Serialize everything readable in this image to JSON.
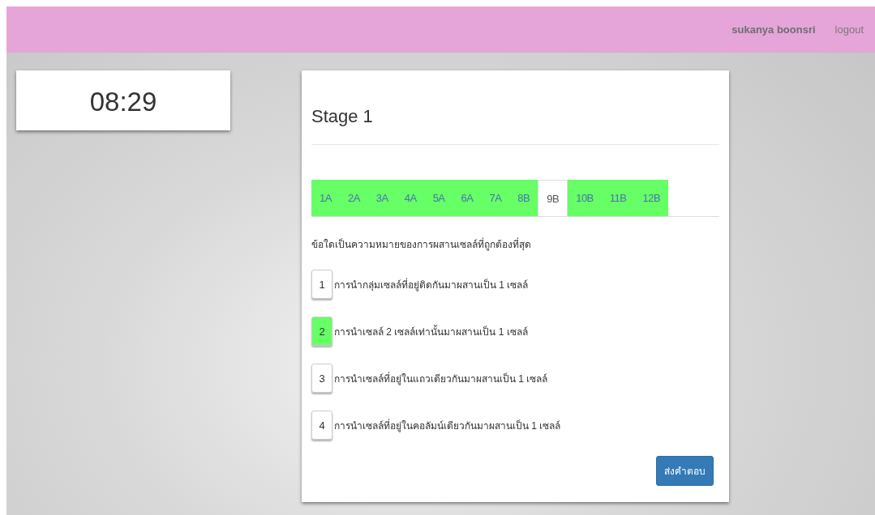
{
  "navbar": {
    "user": "sukanya boonsri",
    "logout": "logout"
  },
  "timer": "08:29",
  "stage": {
    "title": "Stage 1",
    "tabs": [
      {
        "label": "1A",
        "answered": true,
        "selected": false
      },
      {
        "label": "2A",
        "answered": true,
        "selected": false
      },
      {
        "label": "3A",
        "answered": true,
        "selected": false
      },
      {
        "label": "4A",
        "answered": true,
        "selected": false
      },
      {
        "label": "5A",
        "answered": true,
        "selected": false
      },
      {
        "label": "6A",
        "answered": true,
        "selected": false
      },
      {
        "label": "7A",
        "answered": true,
        "selected": false
      },
      {
        "label": "8B",
        "answered": true,
        "selected": false
      },
      {
        "label": "9B",
        "answered": false,
        "selected": true
      },
      {
        "label": "10B",
        "answered": true,
        "selected": false
      },
      {
        "label": "11B",
        "answered": true,
        "selected": false
      },
      {
        "label": "12B",
        "answered": true,
        "selected": false
      }
    ],
    "question": "ข้อใดเป็นความหมายของการผสานเซลล์ที่ถูกต้องที่สุด",
    "options": [
      {
        "number": "1",
        "text": "การนำกลุ่มเซลล์ที่อยู่ติดกันมาผสานเป็น 1 เซลล์",
        "selected": false
      },
      {
        "number": "2",
        "text": "การนำเซลล์ 2 เซลล์เท่านั้นมาผสานเป็น 1 เซลล์",
        "selected": true
      },
      {
        "number": "3",
        "text": "การนำเซลล์ที่อยู่ในแถวเดียวกันมาผสานเป็น 1 เซลล์",
        "selected": false
      },
      {
        "number": "4",
        "text": "การนำเซลล์ที่อยู่ในคอลัมน์เดียวกันมาผสานเป็น 1 เซลล์",
        "selected": false
      }
    ],
    "submit": "ส่งคำตอบ"
  }
}
